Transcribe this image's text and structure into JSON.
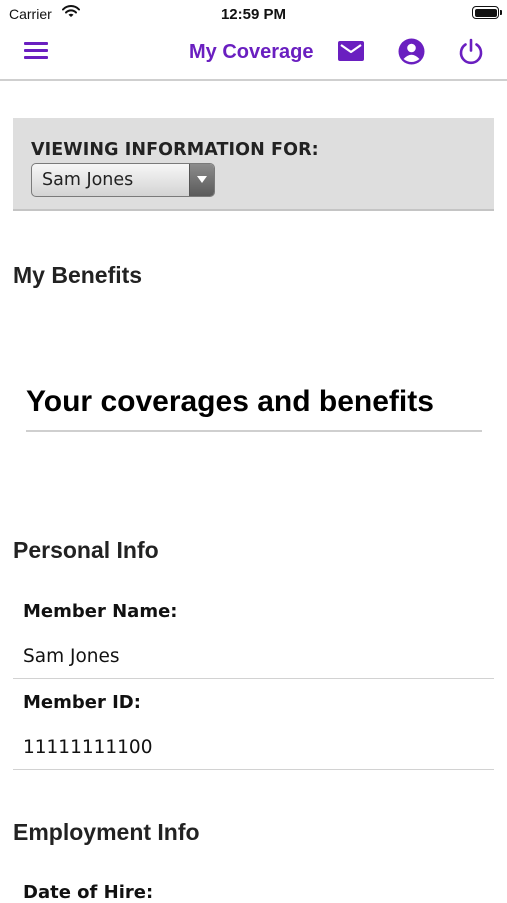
{
  "status_bar": {
    "carrier": "Carrier",
    "time": "12:59 PM"
  },
  "nav": {
    "title": "My Coverage",
    "accent_color": "#6a1fc0"
  },
  "viewing": {
    "label": "VIEWING INFORMATION FOR:",
    "selected_member": "Sam Jones"
  },
  "my_benefits": {
    "heading": "My Benefits",
    "coverages_title": "Your coverages and benefits"
  },
  "personal_info": {
    "heading": "Personal Info",
    "member_name_label": "Member Name:",
    "member_name_value": "Sam Jones",
    "member_id_label": "Member ID:",
    "member_id_value": "11111111100"
  },
  "employment_info": {
    "heading": "Employment Info",
    "date_of_hire_label": "Date of Hire:"
  },
  "icons": [
    "menu-icon",
    "mail-icon",
    "account-icon",
    "power-icon",
    "wifi-icon",
    "battery-icon"
  ]
}
